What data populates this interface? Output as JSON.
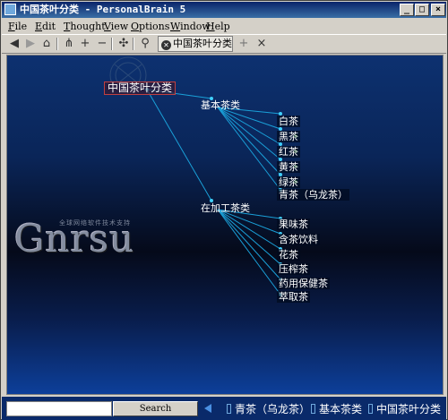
{
  "window": {
    "title": "中国茶叶分类 - PersonalBrain 5",
    "buttons": [
      "_",
      "□",
      "×"
    ]
  },
  "menu": {
    "items": [
      {
        "key": "F",
        "rest": "ile"
      },
      {
        "key": "E",
        "rest": "dit"
      },
      {
        "key": "T",
        "rest": "hought"
      },
      {
        "key": "V",
        "rest": "iew"
      },
      {
        "key": "O",
        "rest": "ptions"
      },
      {
        "key": "W",
        "rest": "indow"
      },
      {
        "key": "H",
        "rest": "elp"
      }
    ]
  },
  "toolbar": {
    "tab_label": "中国茶叶分类",
    "icons": {
      "back": "◀",
      "forward": "▶",
      "home": "⌂",
      "tree": "⋔",
      "add": "+",
      "remove": "−",
      "network": "✣",
      "search": "⚲",
      "new_tab": "+",
      "close_tab": "×"
    }
  },
  "plex": {
    "logo": "Gnrsu",
    "logo_small": "全球网络软件技术支持",
    "central": "中国茶叶分类",
    "groups": [
      {
        "label": "基本茶类",
        "children": [
          "白茶",
          "黑茶",
          "红茶",
          "黄茶",
          "绿茶",
          "青茶（乌龙茶）"
        ]
      },
      {
        "label": "在加工茶类",
        "children": [
          "果味茶",
          "含茶饮料",
          "花茶",
          "压榨茶",
          "药用保健茶",
          "萃取茶"
        ]
      }
    ]
  },
  "bottombar": {
    "search_value": "",
    "search_button": "Search",
    "pins": [
      "青茶（乌龙茶）",
      "基本茶类",
      "中国茶叶分类"
    ]
  }
}
